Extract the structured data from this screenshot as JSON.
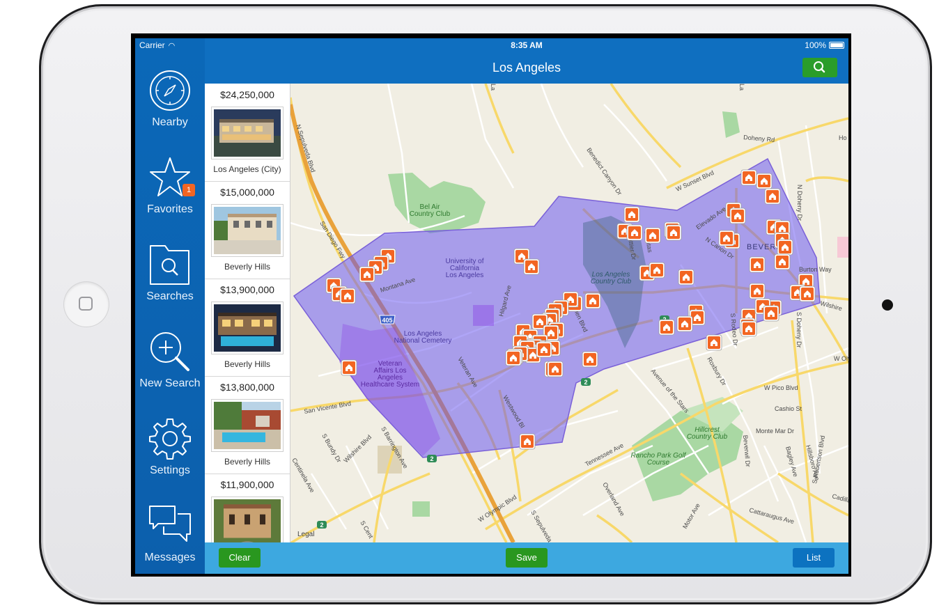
{
  "status_bar": {
    "carrier": "Carrier",
    "time": "8:35 AM",
    "battery": "100%"
  },
  "header": {
    "title": "Los Angeles"
  },
  "sidebar": {
    "items": [
      {
        "label": "Nearby",
        "icon": "compass-icon"
      },
      {
        "label": "Favorites",
        "icon": "star-icon",
        "badge": "1"
      },
      {
        "label": "Searches",
        "icon": "folder-search-icon"
      },
      {
        "label": "New Search",
        "icon": "magnifier-plus-icon"
      },
      {
        "label": "Settings",
        "icon": "gear-icon"
      },
      {
        "label": "Messages",
        "icon": "chat-bubbles-icon"
      }
    ]
  },
  "listings": [
    {
      "price": "$24,250,000",
      "location": "Los Angeles (City)"
    },
    {
      "price": "$15,000,000",
      "location": "Beverly Hills"
    },
    {
      "price": "$13,900,000",
      "location": "Beverly Hills"
    },
    {
      "price": "$13,800,000",
      "location": "Beverly Hills"
    },
    {
      "price": "$11,900,000",
      "location": ""
    }
  ],
  "map": {
    "labels": {
      "bel_air": [
        "Bel Air",
        "Country Club"
      ],
      "ucla": [
        "University of",
        "California",
        "Los Angeles"
      ],
      "lacc": [
        "Los Angeles",
        "Country Club"
      ],
      "cemetery": [
        "Los Angeles",
        "National Cemetery"
      ],
      "va": [
        "Veteran",
        "Affairs Los",
        "Angeles",
        "Healthcare System"
      ],
      "hillcrest": [
        "Hillcrest",
        "Country Club"
      ],
      "rancho": [
        "Rancho Park Golf",
        "Course"
      ],
      "beverly": [
        "BEVERLY"
      ],
      "legal": "Legal",
      "streets": {
        "sepulveda": "N Sepulveda Blvd",
        "sandiego": "San Diego Fwy",
        "montana": "Montana Ave",
        "hilgard": "Hilgard Ave",
        "benedict": "Benedict Canyon Dr",
        "sunset": "W Sunset Blvd",
        "doheny_rd": "Doheny Rd",
        "ho": "Ho",
        "elevado": "Elevado Ave",
        "canon": "N Canon Dr",
        "whittier": "Whittier Dr",
        "lomitas": "Lomitas",
        "glen": "Glen Blvd",
        "veteran": "Veteran Ave",
        "westwood": "Westwood Bl",
        "sanvicente": "San Vicente Blvd",
        "wilshire": "Wilshire Blvd",
        "barrington": "S Barrington Ave",
        "bundy": "S Bundy Dr",
        "centinela": "Centinela Ave",
        "olympic": "W Olympic Blvd",
        "tennessee": "Tennessee Ave",
        "overland": "Overland Ave",
        "pico": "W Pico Blvd",
        "cashio": "Cashio St",
        "montemar": "Monte Mar Dr",
        "roxbury": "Roxbury Dr",
        "stars": "Avenue of the Stars",
        "rodeo": "S Rodeo Dr",
        "beverwil": "Beverwil Dr",
        "motor": "Motor Ave",
        "cattaraugus": "Cattaraugus Ave",
        "cadillac": "Cadillac",
        "hillsboro": "Hillsboro Ave",
        "robertson": "S Robertson Blvd",
        "bagley": "Bagley Ave",
        "burton": "Burton Way",
        "doheny_n": "N Doheny Dr",
        "doheny_s": "S Doheny Dr",
        "wilshire_r": "Wilshire",
        "wolym": "W Oly",
        "lacanon": "La",
        "sepulveda_s": "S Sepulveda",
        "centre": "S Cent"
      },
      "highways": [
        "405",
        "2",
        "2",
        "2",
        "2"
      ]
    }
  },
  "footer": {
    "clear": "Clear",
    "save": "Save",
    "list": "List"
  },
  "colors": {
    "sidebar": "#0c64b2",
    "topbar": "#0f6fc0",
    "bottombar": "#3da8e0",
    "accent_green": "#29971f",
    "marker": "#f26522",
    "polygon": "#6d55f0"
  }
}
